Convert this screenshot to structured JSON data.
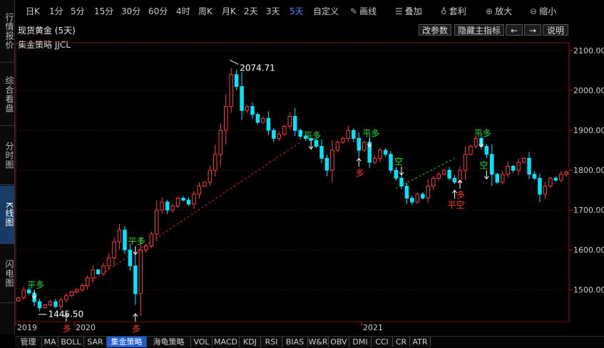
{
  "sidebar": {
    "tabs": [
      {
        "label": "行情报价",
        "active": false
      },
      {
        "label": "综合看盘",
        "active": false
      },
      {
        "label": "分时图",
        "active": false
      },
      {
        "label": "K线图",
        "active": true
      },
      {
        "label": "闪电图",
        "active": false
      }
    ]
  },
  "toolbar": {
    "periods": [
      "日K",
      "1分",
      "5分",
      "15分",
      "30分",
      "60分",
      "4时",
      "周K",
      "月K",
      "2天",
      "3天",
      "5天",
      "自定义"
    ],
    "active_period": "5天",
    "draw": "画线",
    "overlay": "叠加",
    "arbitrage": "套利",
    "zoom_in": "放大",
    "zoom_out": "缩小"
  },
  "header": {
    "title": "现货黄金 (5天)",
    "edit_params": "改参数",
    "hide_indicator": "隐藏主指标",
    "prev_arrow": "←",
    "next_arrow": "→",
    "help": "说明"
  },
  "strategy_label": "集金策略  JJCL",
  "bottom_tabs": [
    "管理",
    "MA",
    "BOLL",
    "SAR",
    "集金策略",
    "海龟策略",
    "VOL",
    "MACD",
    "KDJ",
    "RSI",
    "BIAS",
    "W&R",
    "OBV",
    "DMI",
    "CCI",
    "CR",
    "ATR"
  ],
  "active_bottom_tab": "集金策略",
  "colors": {
    "up": "#ff3b3b",
    "down": "#00e5ff",
    "signal_green": "#22dd22",
    "signal_red": "#ff3333",
    "active_blue": "#3e8cff"
  },
  "chart_data": {
    "type": "candlestick",
    "x_labels": [
      {
        "label": "2019",
        "index": 0
      },
      {
        "label": "2020",
        "index": 11
      },
      {
        "label": "2021",
        "index": 65
      }
    ],
    "y_ticks": [
      1500,
      1600,
      1700,
      1800,
      1900,
      2000,
      2100
    ],
    "y_tick_labels": [
      "1500.00",
      "1600.00",
      "1700.00",
      "1800.00",
      "1900.00",
      "2000.00",
      "2100.00"
    ],
    "ylim": [
      1420,
      2120
    ],
    "n_bars": 104,
    "annotations": {
      "high": {
        "label": "2074.71",
        "value": 2074.71,
        "index": 40
      },
      "low": {
        "label": "1445.50",
        "value": 1445.5,
        "index": 4
      }
    },
    "signals": [
      {
        "text": "平多",
        "index": 3,
        "value": 1505,
        "color": "green",
        "arrow": "down"
      },
      {
        "text": "多",
        "index": 9,
        "value": 1440,
        "color": "red",
        "arrow": "up"
      },
      {
        "text": "平多",
        "index": 22,
        "value": 1615,
        "color": "green",
        "arrow": "down"
      },
      {
        "text": "多",
        "index": 22,
        "value": 1440,
        "color": "red",
        "arrow": "up"
      },
      {
        "text": "平多",
        "index": 55,
        "value": 1880,
        "color": "green",
        "arrow": "down"
      },
      {
        "text": "多",
        "index": 64,
        "value": 1830,
        "color": "red",
        "arrow": "up"
      },
      {
        "text": "平多",
        "index": 66,
        "value": 1885,
        "color": "green",
        "arrow": "down"
      },
      {
        "text": "空",
        "index": 72,
        "value": 1815,
        "color": "green",
        "arrow": "down"
      },
      {
        "text": "平空",
        "index": 82,
        "value": 1750,
        "color": "red",
        "arrow": "up"
      },
      {
        "text": "多",
        "index": 83,
        "value": 1775,
        "color": "red",
        "arrow": "up"
      },
      {
        "text": "平多",
        "index": 87,
        "value": 1885,
        "color": "green",
        "arrow": "down"
      },
      {
        "text": "空",
        "index": 88,
        "value": 1805,
        "color": "green",
        "arrow": "down"
      }
    ],
    "trend_lines": [
      {
        "color": "red",
        "from": {
          "index": 9,
          "value": 1480
        },
        "to": {
          "index": 53,
          "value": 1870
        }
      },
      {
        "color": "green",
        "from": {
          "index": 71,
          "value": 1755
        },
        "to": {
          "index": 82,
          "value": 1830
        }
      }
    ],
    "closes": [
      1480,
      1500,
      1492,
      1470,
      1455,
      1462,
      1470,
      1458,
      1475,
      1485,
      1495,
      1500,
      1510,
      1530,
      1550,
      1540,
      1560,
      1580,
      1620,
      1650,
      1600,
      1560,
      1490,
      1600,
      1610,
      1640,
      1700,
      1720,
      1700,
      1710,
      1730,
      1725,
      1715,
      1740,
      1760,
      1770,
      1800,
      1840,
      1900,
      1960,
      2040,
      2010,
      1950,
      1960,
      1940,
      1920,
      1930,
      1900,
      1880,
      1890,
      1910,
      1935,
      1900,
      1885,
      1880,
      1875,
      1860,
      1830,
      1800,
      1850,
      1870,
      1880,
      1900,
      1880,
      1850,
      1870,
      1820,
      1830,
      1850,
      1840,
      1800,
      1780,
      1760,
      1730,
      1720,
      1740,
      1730,
      1760,
      1780,
      1790,
      1800,
      1780,
      1770,
      1800,
      1840,
      1860,
      1880,
      1860,
      1840,
      1790,
      1770,
      1790,
      1810,
      1800,
      1820,
      1830,
      1790,
      1780,
      1740,
      1760,
      1780,
      1775,
      1790,
      1795
    ]
  }
}
